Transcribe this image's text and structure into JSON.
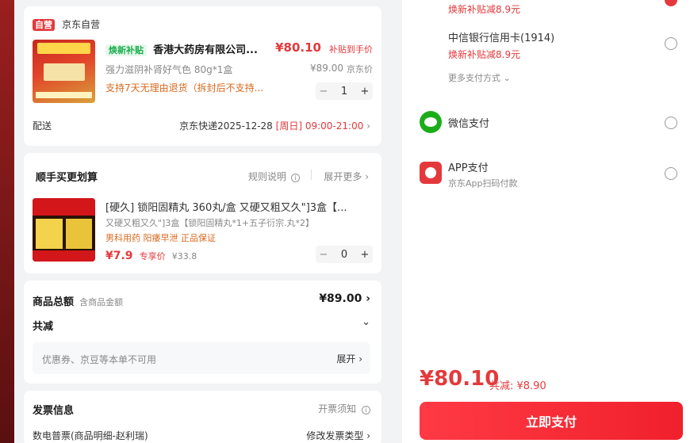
{
  "store": {
    "badge": "自营",
    "name": "京东自营"
  },
  "product": {
    "subsidy_badge": "焕新补贴",
    "title": "香港大药房有限公司...",
    "price": "¥80.10",
    "price_note": "补贴到手价",
    "spec": "强力滋阴补肾好气色 80g*1盒",
    "original_price": "¥89.00",
    "original_note": "京东价",
    "return_policy": "支持7天无理由退货（拆封后不支持...",
    "quantity": "1",
    "minus": "−",
    "plus": "+"
  },
  "delivery": {
    "label": "配送",
    "info": "京东快递2025-12-28",
    "weekday": "[周日]",
    "time": "09:00-21:00"
  },
  "addon": {
    "title": "顺手买更划算",
    "rules_link": "规则说明",
    "more_link": "展开更多",
    "product_title": "[硬久] 锁阳固精丸 360丸/盒 又硬又粗又久\"]3盒【...",
    "product_desc": "又硬又粗又久\"]3盒【锁阳固精丸*1+五子衍宗.丸*2】",
    "tag1": "男科用药",
    "tag2": "阳痿早泄",
    "tag3": "正品保证",
    "price": "¥7.9",
    "price_note": "专享价",
    "old_price": "¥33.8",
    "quantity": "0",
    "minus": "−",
    "plus": "+"
  },
  "summary": {
    "total_label": "商品总额",
    "total_sub": "含商品金额",
    "total_value": "¥89.00",
    "reduce_label": "共减",
    "coupon_text": "优惠券、京豆等本单不可用",
    "coupon_expand": "展开"
  },
  "invoice": {
    "title": "发票信息",
    "notice": "开票须知",
    "type": "数电普票(商品明细-赵利瑞)",
    "modify": "修改发票类型"
  },
  "payment": {
    "top_subsidy": "焕新补贴减8.9元",
    "citic_name": "中信银行信用卡(1914)",
    "citic_subsidy": "焕新补贴减8.9元",
    "more_methods": "更多支付方式",
    "wechat": "微信支付",
    "app_pay": "APP支付",
    "app_pay_sub": "京东App扫码付款",
    "final_price": "¥80.10",
    "total_reduce": "共减: ¥8.90",
    "pay_button": "立即支付"
  },
  "colors": {
    "accent": "#e4393c",
    "wechat": "#1aad19",
    "jd_red": "#e4393c"
  }
}
